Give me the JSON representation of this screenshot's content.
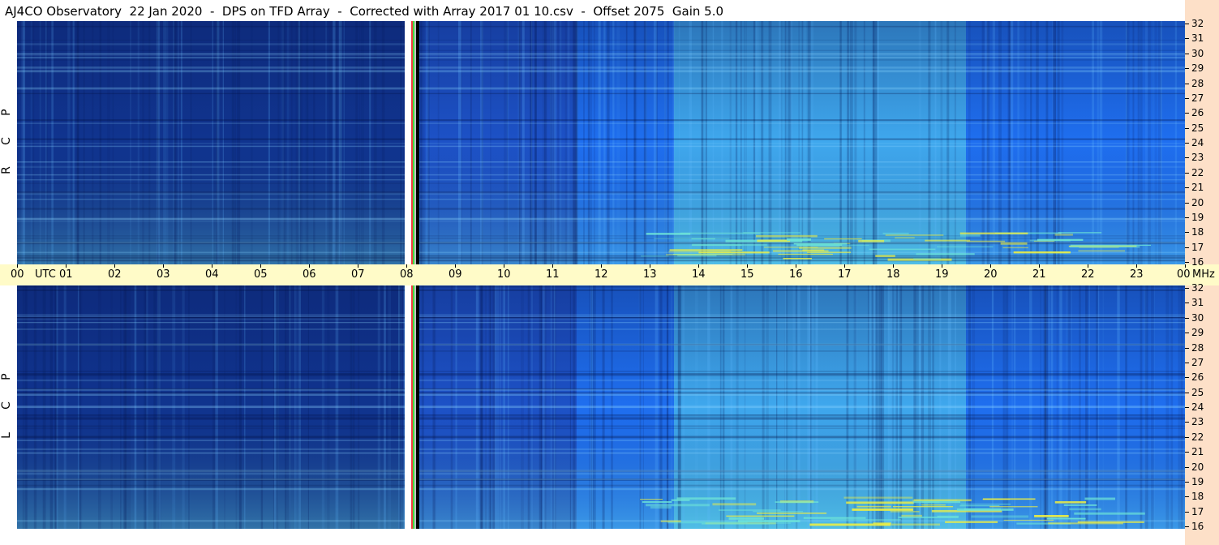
{
  "header": {
    "title": "AJ4CO Observatory  22 Jan 2020  -  DPS on TFD Array  -  Corrected with Array 2017 01 10.csv  -  Offset 2075  Gain 5.0"
  },
  "panels": [
    {
      "id": "rcp",
      "label": "R C P"
    },
    {
      "id": "lcp",
      "label": "L C P"
    }
  ],
  "time_axis": {
    "ticks": [
      "00",
      "01",
      "02",
      "03",
      "04",
      "05",
      "06",
      "07",
      "08",
      "09",
      "10",
      "11",
      "12",
      "13",
      "14",
      "15",
      "16",
      "17",
      "18",
      "19",
      "20",
      "21",
      "22",
      "23",
      "00"
    ],
    "utc_label": "UTC",
    "unit_label": "MHz"
  },
  "freq_axis": {
    "ticks": [
      "32",
      "31",
      "30",
      "29",
      "28",
      "27",
      "26",
      "25",
      "24",
      "23",
      "22",
      "21",
      "20",
      "19",
      "18",
      "17",
      "16"
    ]
  },
  "colors": {
    "low": "#0a1a5a",
    "mid": "#1f6ff0",
    "high": "#6fe6d6",
    "peak": "#f0f040",
    "time_bar": "#fffbc8",
    "freq_strip": "#fde0c8"
  },
  "chart_data": {
    "type": "heatmap",
    "title": "AJ4CO Observatory  22 Jan 2020  -  DPS on TFD Array  -  Corrected with Array 2017 01 10.csv  -  Offset 2075  Gain 5.0",
    "x_axis": {
      "label": "UTC",
      "range": [
        0,
        24
      ],
      "unit": "hours"
    },
    "y_axis": {
      "label": "MHz",
      "range": [
        16,
        32
      ]
    },
    "panels": [
      "R C P",
      "L C P"
    ],
    "gap_utc": [
      8.0,
      8.3
    ],
    "regions": [
      {
        "utc_start": 0,
        "utc_end": 8,
        "level": "low"
      },
      {
        "utc_start": 8.3,
        "utc_end": 11.5,
        "level": "low-mid"
      },
      {
        "utc_start": 11.5,
        "utc_end": 13.5,
        "level": "mid"
      },
      {
        "utc_start": 13.5,
        "utc_end": 19.5,
        "level": "high"
      },
      {
        "utc_start": 19.5,
        "utc_end": 24,
        "level": "mid"
      }
    ]
  }
}
